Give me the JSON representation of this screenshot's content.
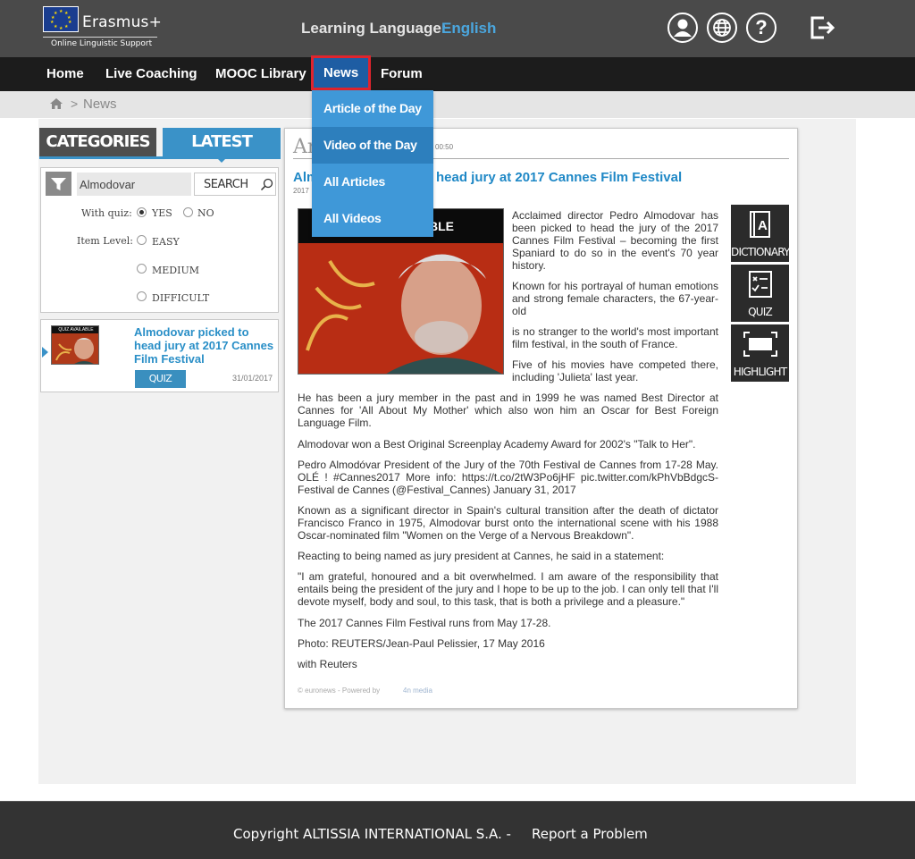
{
  "brand": {
    "name": "Erasmus+",
    "subtitle": "Online Linguistic Support"
  },
  "header": {
    "learning_label": "Learning Language:",
    "learning_value": "English",
    "icons": [
      "user-icon",
      "globe-icon",
      "help-icon",
      "logout-icon"
    ],
    "help_glyph": "?"
  },
  "nav": {
    "items": [
      {
        "label": "Home"
      },
      {
        "label": "Live Coaching"
      },
      {
        "label": "MOOC Library"
      },
      {
        "label": "News"
      },
      {
        "label": "Forum"
      }
    ],
    "active": "News"
  },
  "dropdown": {
    "items": [
      {
        "label": "Article of the Day"
      },
      {
        "label": "Video of the Day"
      },
      {
        "label": "All Articles"
      },
      {
        "label": "All Videos"
      }
    ],
    "highlighted": "Video of the Day"
  },
  "breadcrumb": {
    "separator": ">",
    "current": "News"
  },
  "left_panel": {
    "tab_categories": "CATEGORIES",
    "tab_latest": "LATEST",
    "search": {
      "value": "Almodovar",
      "button": "SEARCH"
    },
    "with_quiz": {
      "label": "With quiz:",
      "yes": "YES",
      "no": "NO",
      "selected": "YES"
    },
    "item_level": {
      "label": "Item Level:",
      "options": [
        "EASY",
        "MEDIUM",
        "DIFFICULT"
      ]
    },
    "result": {
      "thumb_badge": "QUIZ AVAILABLE",
      "title": "Almodovar picked to head jury at 2017 Cannes Film Festival",
      "quiz_button": "QUIZ",
      "date": "31/01/2017"
    }
  },
  "article": {
    "heading_partial": "Ar",
    "time": "00:50",
    "title_left": "Alm",
    "title_right": "head jury at 2017 Cannes Film Festival",
    "year_partial": "2017",
    "photo_band_text": "BLE",
    "side_paragraphs": [
      "Acclaimed director Pedro Almodovar has been picked to head the jury of the 2017 Cannes Film Festival – becoming the first Spaniard to do so in the event's 70 year history.",
      "Known for his portrayal of human emotions and strong female characters, the 67-year-old",
      "is no stranger to the world's most important film festival, in the south of France.",
      "Five of his movies have competed there, including 'Julieta' last year."
    ],
    "paragraphs": [
      "He has been a jury member in the past and in 1999 he was named Best Director at Cannes for 'All About My Mother' which also won him an Oscar for Best Foreign Language Film.",
      "Almodovar won a Best Original Screenplay Academy Award for 2002's \"Talk to Her\".",
      "Pedro Almodóvar President of the Jury of the 70th Festival de Cannes from 17-28 May. OLÉ ! #Cannes2017 More info: https://t.co/2tW3Po6jHF pic.twitter.com/kPhVbBdgcS- Festival de Cannes (@Festival_Cannes) January 31, 2017",
      "Known as a significant director in Spain's cultural transition after the death of dictator Francisco Franco in 1975, Almodovar burst onto the international scene with his 1988 Oscar-nominated film \"Women on the Verge of a Nervous Breakdown\".",
      "Reacting to being named as jury president at Cannes, he said in a statement:",
      "\"I am grateful, honoured and a bit overwhelmed. I am aware of the responsibility that entails being the president of the jury and I hope to be up to the job. I can only tell that I'll devote myself, body and soul, to this task, that is both a privilege and a pleasure.\"",
      "The 2017 Cannes Film Festival runs from May 17-28.",
      "Photo: REUTERS/Jean-Paul Pelissier, 17 May 2016",
      "with Reuters"
    ],
    "footer": "© euronews - Powered by",
    "footer_brand": "4n media"
  },
  "tools": {
    "dictionary": "DICTIONARY",
    "quiz": "QUIZ",
    "highlight": "HIGHLIGHT"
  },
  "footer": {
    "copyright": "Copyright ALTISSIA INTERNATIONAL S.A. -",
    "report": "Report a Problem"
  },
  "colors": {
    "header_bg": "#4a4a4a",
    "nav_bg": "#1c1c1c",
    "accent_blue": "#3a92c8",
    "dropdown_bg": "#3f98d8",
    "active_outline": "#e0242d",
    "link_blue": "#1f88c6"
  }
}
